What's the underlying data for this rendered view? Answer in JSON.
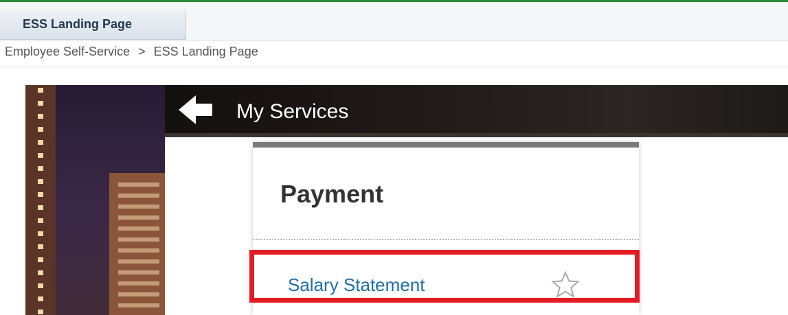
{
  "tab": {
    "label": "ESS Landing Page"
  },
  "breadcrumb": {
    "items": [
      "Employee Self-Service",
      "ESS Landing Page"
    ],
    "separator": ">"
  },
  "header": {
    "title": "My Services",
    "back_icon": "arrow-left-icon"
  },
  "card": {
    "title": "Payment",
    "items": [
      {
        "label": "Salary Statement",
        "icon": "star-outline-icon",
        "favorite": false
      }
    ]
  },
  "colors": {
    "link": "#1f6fa8",
    "highlight": "#e51b24",
    "header_bg": "#1f1917",
    "card_top_border": "#7a7a7a",
    "accent_line": "#2f8a3e"
  }
}
